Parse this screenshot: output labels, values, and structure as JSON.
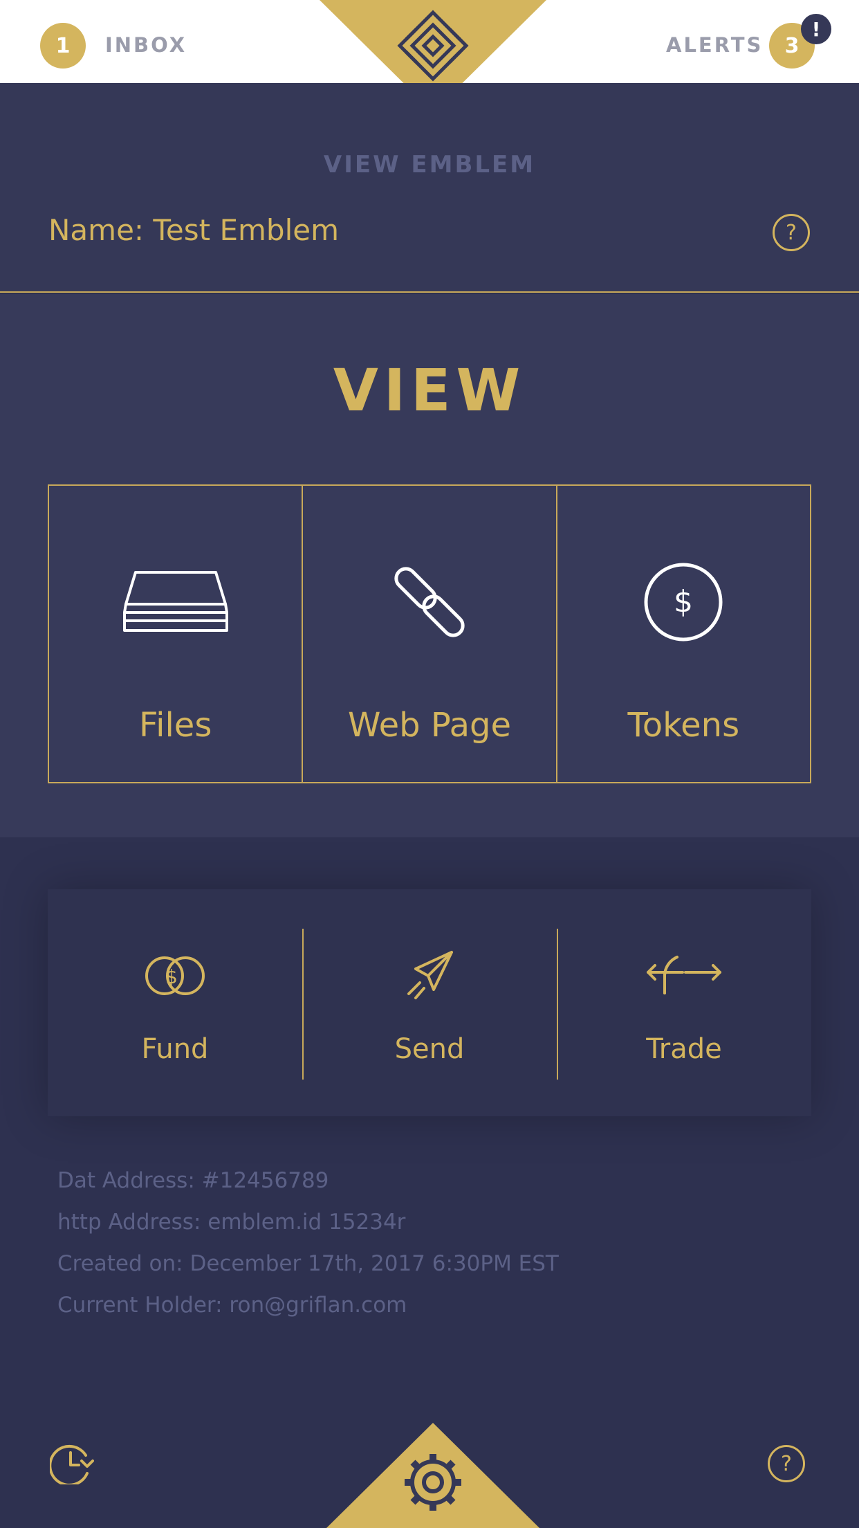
{
  "header": {
    "inbox_count": "1",
    "inbox_label": "INBOX",
    "alerts_label": "ALERTS",
    "alerts_count": "3",
    "alert_indicator": "!",
    "logo_icon": "emblem-logo-icon"
  },
  "emblem": {
    "section_title": "VIEW EMBLEM",
    "name": "Name: Test Emblem",
    "help": "?"
  },
  "view": {
    "title": "VIEW",
    "items": [
      {
        "label": "Files",
        "icon": "files-stack-icon"
      },
      {
        "label": "Web Page",
        "icon": "chain-link-icon"
      },
      {
        "label": "Tokens",
        "icon": "dollar-coin-icon"
      }
    ]
  },
  "actions": {
    "items": [
      {
        "label": "Fund",
        "icon": "fund-coins-icon"
      },
      {
        "label": "Send",
        "icon": "paper-plane-icon"
      },
      {
        "label": "Trade",
        "icon": "trade-arrows-icon"
      }
    ]
  },
  "info": {
    "dat_address": "Dat Address: #12456789",
    "http_address": "http Address: emblem.id 15234r",
    "created_on": "Created on: December 17th, 2017 6:30PM EST",
    "current_holder": "Current Holder: ron@griflan.com"
  },
  "footer": {
    "history_icon": "history-clock-icon",
    "settings_icon": "gear-icon",
    "help": "?"
  },
  "colors": {
    "gold": "#d4b55e",
    "navy": "#353857",
    "navy_dark": "#2e3150",
    "muted": "#5c6187"
  }
}
